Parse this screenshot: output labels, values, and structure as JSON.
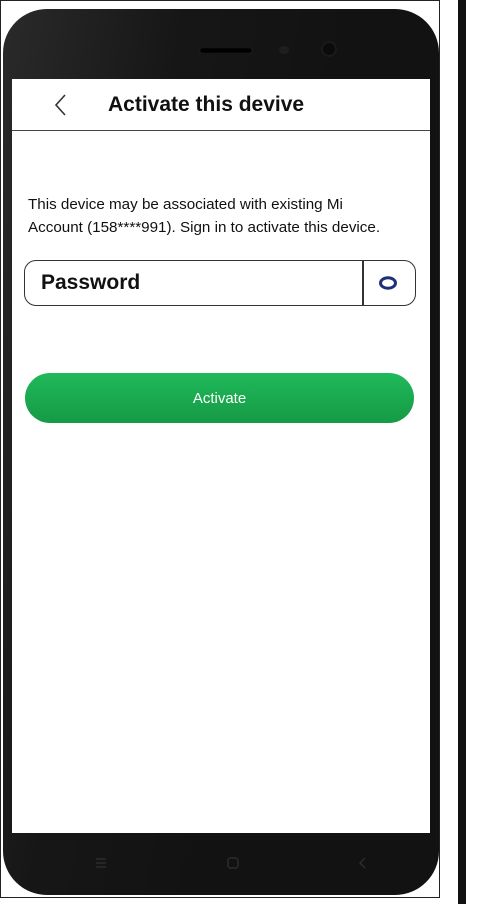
{
  "header": {
    "title": "Activate this devive"
  },
  "message": {
    "line1": "This device may be associated with existing Mi",
    "line2": "Account (158****991). Sign in to activate this device."
  },
  "password_field": {
    "placeholder": "Password",
    "value": ""
  },
  "activate_button": {
    "label": "Activate"
  },
  "icons": {
    "back": "chevron-left-icon",
    "eye": "eye-icon",
    "nav_menu": "menu-icon",
    "nav_home": "home-icon",
    "nav_back": "nav-back-icon"
  },
  "colors": {
    "accent": "#1fb95a",
    "eye_icon": "#1f2f7a",
    "device_body": "#121212"
  }
}
